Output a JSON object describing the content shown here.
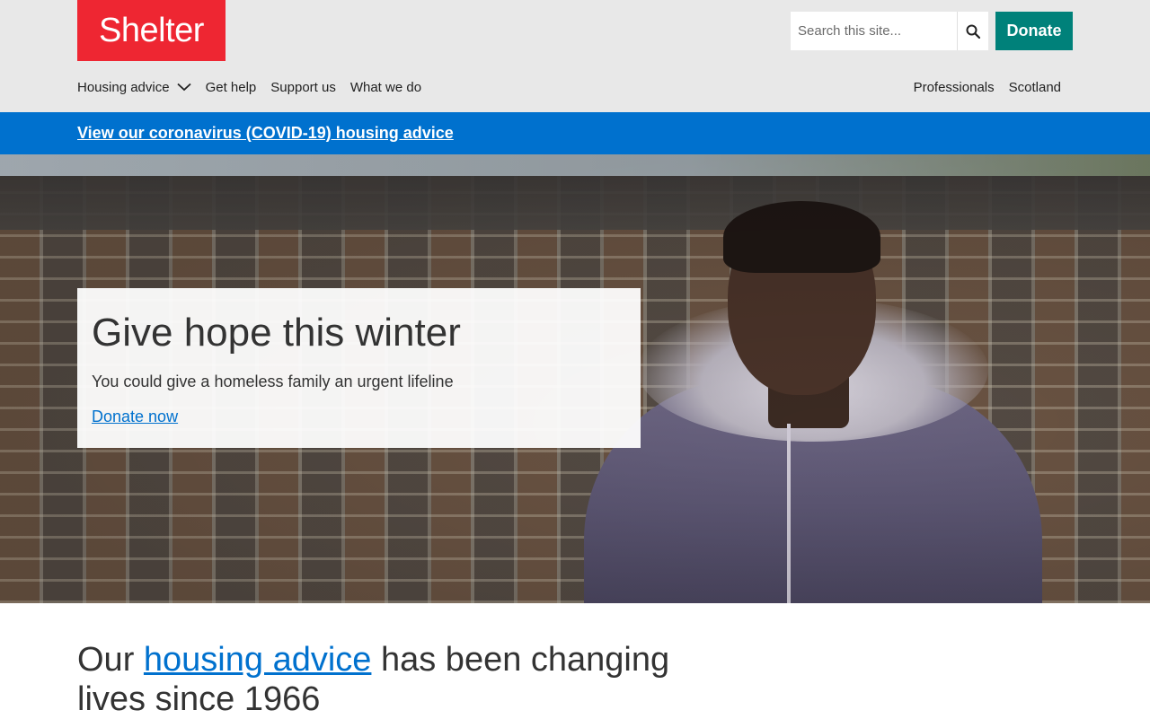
{
  "header": {
    "logo_text": "Shelter",
    "search_placeholder": "Search this site...",
    "donate_label": "Donate",
    "nav_left": [
      {
        "label": "Housing advice"
      },
      {
        "label": "Get help"
      },
      {
        "label": "Support us"
      },
      {
        "label": "What we do"
      }
    ],
    "nav_right": [
      {
        "label": "Professionals"
      },
      {
        "label": "Scotland"
      }
    ]
  },
  "banner": {
    "link_text": "View our coronavirus (COVID-19) housing advice"
  },
  "hero": {
    "title": "Give hope this winter",
    "subtitle": "You could give a homeless family an urgent lifeline",
    "cta": "Donate now"
  },
  "headline": {
    "prefix": "Our ",
    "link": "housing advice",
    "suffix": " has been changing lives since 1966"
  },
  "colors": {
    "brand_red": "#ee2632",
    "donate_teal": "#00817a",
    "banner_blue": "#0071ce",
    "header_grey": "#e8e8e8"
  },
  "icons": {
    "search": "search-icon",
    "chevron": "chevron-down-icon"
  }
}
